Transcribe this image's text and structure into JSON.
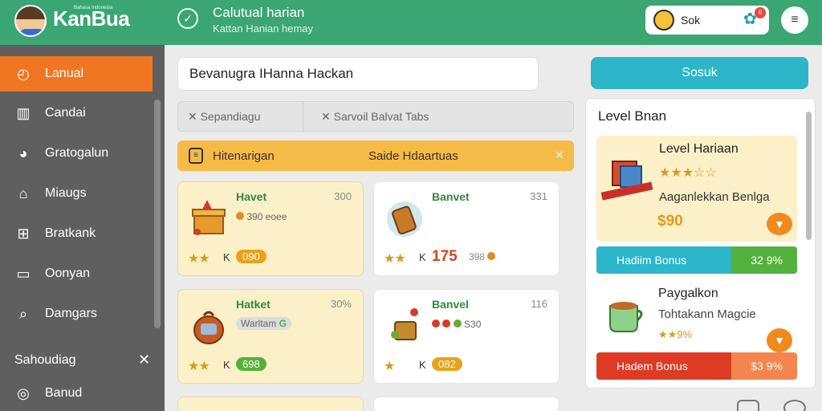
{
  "header": {
    "brand": "KanBua",
    "brand_tagline": "Bahasa Indonesia",
    "title": "Calutual harian",
    "subtitle": "Kattan Hanian hemay",
    "profile_name": "Sok",
    "notification_count": "6",
    "icons": {
      "logo": "avatar-icon",
      "compass": "compass-icon",
      "settings": "gear-icon",
      "menu": "menu-icon"
    }
  },
  "sidebar": {
    "items": [
      {
        "label": "Lanual",
        "icon": "clock-icon",
        "active": true
      },
      {
        "label": "Candai",
        "icon": "book-icon",
        "active": false
      },
      {
        "label": "Gratogalun",
        "icon": "pie-icon",
        "active": false
      },
      {
        "label": "Miaugs",
        "icon": "home-icon",
        "active": false
      },
      {
        "label": "Bratkank",
        "icon": "grid-icon",
        "active": false
      },
      {
        "label": "Oonyan",
        "icon": "window-icon",
        "active": false
      },
      {
        "label": "Damgars",
        "icon": "search-icon",
        "active": false
      }
    ],
    "section_label": "Sahoudiag",
    "footer_item": {
      "label": "Banud",
      "icon": "circle-icon"
    }
  },
  "search": {
    "value": "Bevanugra IHanna Hackan",
    "button_label": "Sosuk"
  },
  "filters": {
    "left": "Sepandiagu",
    "right": "Sarvoil Balvat Tabs"
  },
  "notice": {
    "left": "Hitenarigan",
    "center": "Saide Hdaartuas"
  },
  "cards": [
    {
      "title": "Havet",
      "num": "300",
      "sub": "390 eoee",
      "rating": "3",
      "tag": "K",
      "pill": "090",
      "pill_color": "#e9a21d"
    },
    {
      "title": "Banvet",
      "num": "331",
      "price": "175",
      "price_note": "398",
      "rating": "2",
      "tag": "K"
    },
    {
      "title": "Hatket",
      "num": "30%",
      "sub": "Warltam",
      "sub_badge": "G",
      "rating": "2",
      "tag": "K",
      "pill": "698",
      "pill_color": "#55b13e"
    },
    {
      "title": "Banvel",
      "num": "116",
      "sub": "S30",
      "rating": "1",
      "tag": "K",
      "pill": "082",
      "pill_color": "#e9a21d"
    }
  ],
  "panel": {
    "title": "Level Bnan",
    "level_card": {
      "title": "Level Hariaan",
      "desc": "Aaganlekkan Benlga",
      "price": "$90"
    },
    "bonus1": {
      "label": "Hadiim Bonus",
      "value": "32 9%",
      "fill": 0.67,
      "color_fill": "#2bb6c9",
      "color_rest": "#55b13e"
    },
    "pay": {
      "title": "Paygalkon",
      "desc": "Tohtakann Magcie",
      "stars": "9%"
    },
    "bonus2": {
      "label": "Hadem Bonus",
      "value": "$3 9%",
      "fill": 0.67,
      "color_fill": "#dd3b23",
      "color_rest": "#f4854f"
    }
  },
  "colors": {
    "header": "#3aa673",
    "sidebar": "#5f5f5f",
    "active": "#f07622",
    "accent": "#2bb6c9",
    "notice": "#f6bb47"
  }
}
